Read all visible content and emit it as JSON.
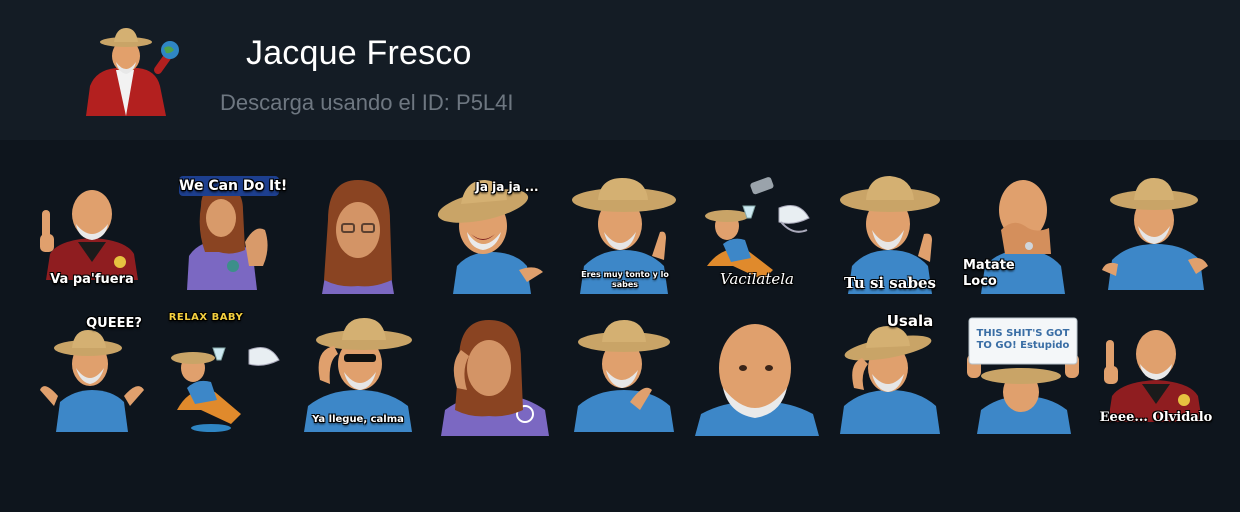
{
  "header": {
    "title": "Jacque Fresco",
    "download_text": "Descarga usando el ID: P5L4I"
  },
  "colors": {
    "background": "#0e151d",
    "header_background": "#141c25",
    "title": "#ffffff",
    "subtitle": "#6e7781"
  },
  "stickers": [
    {
      "caption": "Va pa'fuera"
    },
    {
      "caption": "We Can Do It!"
    },
    {
      "caption": ""
    },
    {
      "caption": "Ja ja ja ..."
    },
    {
      "caption": "Eres muy tonto y lo sabes"
    },
    {
      "caption": "Vacilatela"
    },
    {
      "caption": "Tu si sabes"
    },
    {
      "caption": "Matate Loco"
    },
    {
      "caption": ""
    },
    {
      "caption": "QUEEE?"
    },
    {
      "caption": "RELAX BABY"
    },
    {
      "caption": "Ya llegue, calma"
    },
    {
      "caption": ""
    },
    {
      "caption": ""
    },
    {
      "caption": ""
    },
    {
      "caption": "Usala"
    },
    {
      "caption": "THIS SHIT'S GOT TO GO! Estupido"
    },
    {
      "caption": "Eeee... Olvidalo"
    }
  ]
}
